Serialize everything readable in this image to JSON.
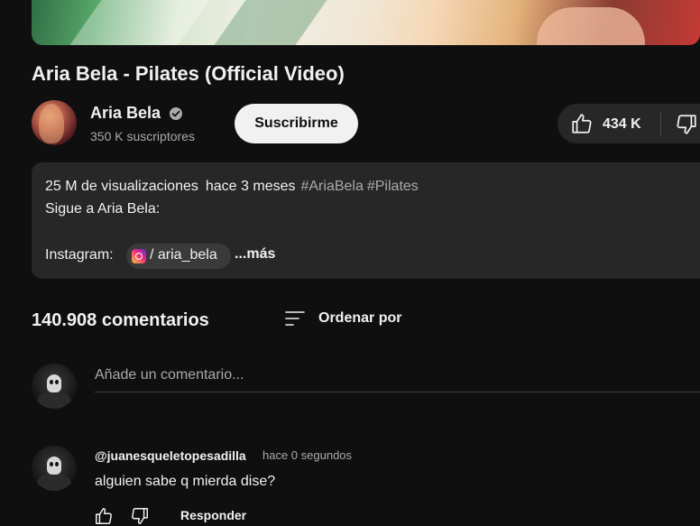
{
  "video": {
    "title": "Aria Bela - Pilates (Official Video)"
  },
  "channel": {
    "name": "Aria Bela",
    "subscribers": "350 K suscriptores",
    "subscribe_label": "Suscribirme"
  },
  "actions": {
    "like_count": "434 K",
    "like_icon": "thumbs-up-icon",
    "dislike_icon": "thumbs-down-icon"
  },
  "description": {
    "views": "25 M de visualizaciones",
    "time_ago": "hace 3 meses",
    "tags": [
      "#AriaBela",
      "#Pilates"
    ],
    "line2": "Sigue a Aria Bela:",
    "instagram_label": "Instagram:",
    "instagram_handle": "/ aria_bela",
    "more_label": "...más"
  },
  "comments": {
    "count_label": "140.908 comentarios",
    "sort_label": "Ordenar por",
    "input_placeholder": "Añade un comentario...",
    "items": [
      {
        "author": "@juanesqueletopesadilla",
        "time": "hace 0 segundos",
        "text": "alguien sabe q mierda dise?",
        "reply_label": "Responder"
      }
    ]
  },
  "colors": {
    "background": "#0f0f0f",
    "surface": "#272727",
    "text_primary": "#f1f1f1",
    "text_secondary": "#aaaaaa",
    "subscribe_bg": "#f1f1f1"
  }
}
